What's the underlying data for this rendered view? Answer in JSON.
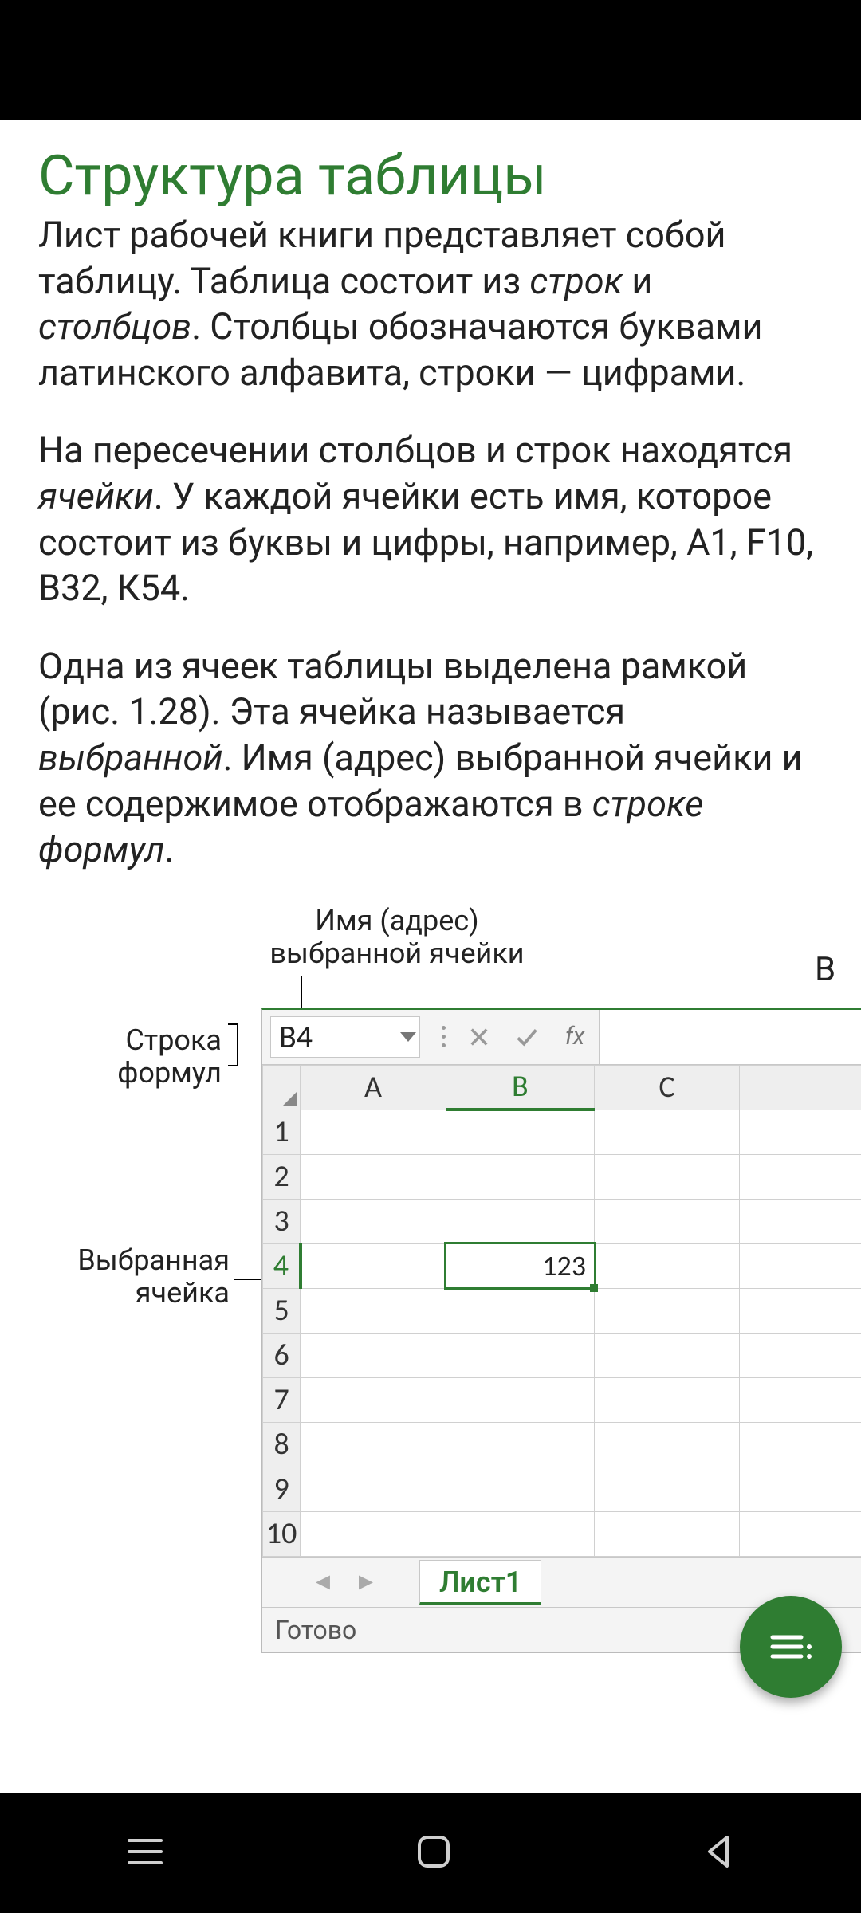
{
  "title": "Структура таблицы",
  "para1_a": "Лист рабочей книги представляет собой таблицу. Таблица состоит из ",
  "para1_i1": "строк",
  "para1_b": " и ",
  "para1_i2": "столбцов",
  "para1_c": ". Столбцы обозначаются буквами латинского алфавита, строки — цифрами.",
  "para2_a": "На пересечении столбцов и строк находятся ",
  "para2_i1": "ячейки",
  "para2_b": ". У каждой ячейки есть имя, которое состоит из буквы и цифры, например, А1, F10, В32, К54.",
  "para3_a": "Одна из ячеек таблицы выделена рамкой (рис. 1.28). Эта ячейка называется ",
  "para3_i1": "выбранной",
  "para3_b": ". Имя (адрес) выбранной ячейки и ее содержимое отображаются в ",
  "para3_i2": "строке формул",
  "para3_c": ".",
  "callout": {
    "addr_line1": "Имя (адрес)",
    "addr_line2": "выбранной ячейки",
    "formula_line1": "Строка",
    "formula_line2": "формул",
    "selected_line1": "Выбранная",
    "selected_line2": "ячейка",
    "right_cut": "В"
  },
  "excel": {
    "name_box": "B4",
    "fx_label": "fx",
    "columns": [
      "A",
      "B",
      "C"
    ],
    "rows": [
      "1",
      "2",
      "3",
      "4",
      "5",
      "6",
      "7",
      "8",
      "9",
      "10"
    ],
    "selected_value": "123",
    "sheet_tab": "Лист1",
    "status": "Готово"
  }
}
